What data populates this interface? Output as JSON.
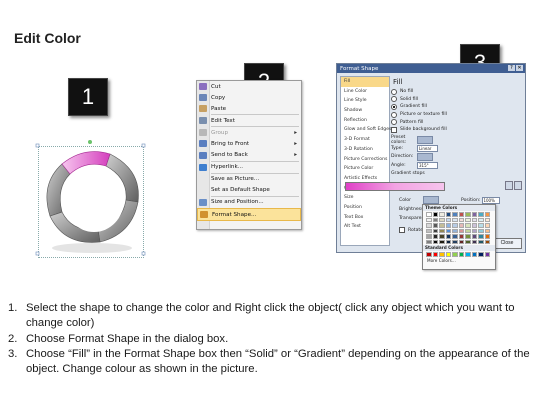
{
  "title": "Edit Color",
  "steps": [
    "1",
    "2",
    "3"
  ],
  "context_menu": {
    "items": [
      {
        "label": "Cut",
        "icon": "scissors-icon",
        "enabled": true,
        "submenu": false,
        "highlight": false,
        "icon_color": "#8b6fbf"
      },
      {
        "label": "Copy",
        "icon": "copy-icon",
        "enabled": true,
        "submenu": false,
        "highlight": false,
        "icon_color": "#6b86b8"
      },
      {
        "label": "Paste",
        "icon": "paste-icon",
        "enabled": true,
        "submenu": false,
        "highlight": false,
        "icon_color": "#c7a062"
      },
      {
        "label": "Edit Text",
        "icon": "edit-text-icon",
        "enabled": true,
        "submenu": false,
        "highlight": false,
        "icon_color": "#7a8fae"
      },
      {
        "label": "Group",
        "icon": "group-icon",
        "enabled": false,
        "submenu": true,
        "highlight": false,
        "icon_color": "#b8b8b8"
      },
      {
        "label": "Bring to Front",
        "icon": "bring-front-icon",
        "enabled": true,
        "submenu": true,
        "highlight": false,
        "icon_color": "#5b7fc0"
      },
      {
        "label": "Send to Back",
        "icon": "send-back-icon",
        "enabled": true,
        "submenu": true,
        "highlight": false,
        "icon_color": "#5b7fc0"
      },
      {
        "label": "Hyperlink...",
        "icon": "hyperlink-icon",
        "enabled": true,
        "submenu": false,
        "highlight": false,
        "icon_color": "#3f7fcf"
      },
      {
        "label": "Save as Picture...",
        "icon": "",
        "enabled": true,
        "submenu": false,
        "highlight": false,
        "icon_color": ""
      },
      {
        "label": "Set as Default Shape",
        "icon": "",
        "enabled": true,
        "submenu": false,
        "highlight": false,
        "icon_color": ""
      },
      {
        "label": "Size and Position...",
        "icon": "size-position-icon",
        "enabled": true,
        "submenu": false,
        "highlight": false,
        "icon_color": "#6a8fc7"
      },
      {
        "label": "Format Shape...",
        "icon": "format-shape-icon",
        "enabled": true,
        "submenu": false,
        "highlight": true,
        "icon_color": "#d1912e"
      }
    ]
  },
  "format_dialog": {
    "title": "Format Shape",
    "categories": [
      "Fill",
      "Line Color",
      "Line Style",
      "Shadow",
      "Reflection",
      "Glow and Soft Edges",
      "3-D Format",
      "3-D Rotation",
      "Picture Corrections",
      "Picture Color",
      "Artistic Effects",
      "Crop",
      "Size",
      "Position",
      "Text Box",
      "Alt Text"
    ],
    "selected_category": "Fill",
    "pane_heading": "Fill",
    "fill_options": [
      {
        "label": "No fill",
        "type": "radio",
        "checked": false
      },
      {
        "label": "Solid fill",
        "type": "radio",
        "checked": false
      },
      {
        "label": "Gradient fill",
        "type": "radio",
        "checked": true
      },
      {
        "label": "Picture or texture fill",
        "type": "radio",
        "checked": false
      },
      {
        "label": "Pattern fill",
        "type": "radio",
        "checked": false
      },
      {
        "label": "Slide background fill",
        "type": "check",
        "checked": false
      }
    ],
    "fields": [
      {
        "label": "Preset colors:",
        "control": "picker"
      },
      {
        "label": "Type:",
        "control": "select",
        "value": "Linear"
      },
      {
        "label": "Direction:",
        "control": "picker"
      },
      {
        "label": "Angle:",
        "control": "select",
        "value": "315°"
      }
    ],
    "gradient_stops_label": "Gradient stops",
    "color_label": "Color",
    "position_label": "Position:",
    "position_value": "100%",
    "brightness_label": "Brightness:",
    "transparency_label": "Transparency:",
    "rotate_label": "Rotate",
    "close_label": "Close"
  },
  "palette": {
    "theme_label": "Theme Colors",
    "standard_label": "Standard Colors",
    "more_label": "More Colors...",
    "theme_rows": [
      [
        "#ffffff",
        "#000000",
        "#eeece1",
        "#1f497d",
        "#4f81bd",
        "#c0504d",
        "#9bbb59",
        "#8064a2",
        "#4bacc6",
        "#f79646"
      ],
      [
        "#f2f2f2",
        "#7f7f7f",
        "#ddd9c3",
        "#c6d9f0",
        "#dbe5f1",
        "#f2dcdb",
        "#ebf1dd",
        "#e5e0ec",
        "#dbeef3",
        "#fdeada"
      ],
      [
        "#d8d8d8",
        "#595959",
        "#c4bd97",
        "#8db3e2",
        "#b8cce4",
        "#e5b9b7",
        "#d7e3bc",
        "#ccc1d9",
        "#b7dde8",
        "#fbd5b5"
      ],
      [
        "#bfbfbf",
        "#3f3f3f",
        "#938953",
        "#548dd4",
        "#95b3d7",
        "#d99694",
        "#c3d69b",
        "#b2a2c7",
        "#92cddc",
        "#fac08f"
      ],
      [
        "#a5a5a5",
        "#262626",
        "#494429",
        "#17365d",
        "#366092",
        "#953734",
        "#76923c",
        "#5f497a",
        "#31859b",
        "#e36c09"
      ],
      [
        "#7f7f7f",
        "#0c0c0c",
        "#1d1b10",
        "#0f243e",
        "#244061",
        "#632423",
        "#4f6128",
        "#3f3151",
        "#205867",
        "#974806"
      ]
    ],
    "standard_row": [
      "#c00000",
      "#ff0000",
      "#ffc000",
      "#ffff00",
      "#92d050",
      "#00b050",
      "#00b0f0",
      "#0070c0",
      "#002060",
      "#7030a0"
    ]
  },
  "instructions": [
    {
      "num": "1.",
      "text": "Select the shape to change the color and Right click the object( click any object which you want to change color)"
    },
    {
      "num": "2.",
      "text": "Choose Format Shape in the dialog box."
    },
    {
      "num": "3.",
      "text": "Choose “Fill” in the Format Shape box then “Solid” or “Gradient” depending on the appearance of the object. Change colour as shown in the picture."
    }
  ],
  "colors": {
    "accent_pink": "#e040c7",
    "ring_gray": "#8a8a8a",
    "menu_highlight": "#fbe39b",
    "dialog_title": "#3f5e92"
  }
}
